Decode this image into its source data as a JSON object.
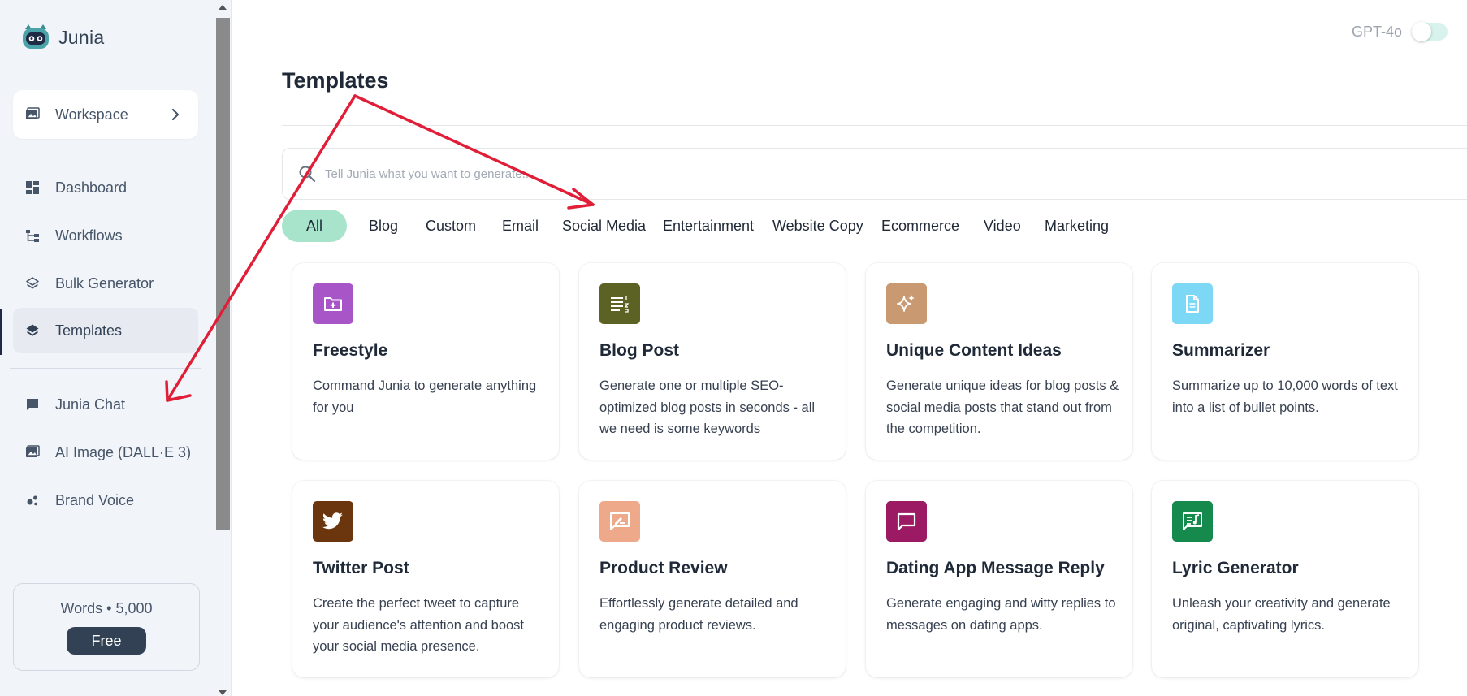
{
  "app": {
    "name": "Junia"
  },
  "sidebar": {
    "workspace": {
      "label": "Workspace",
      "icon": "image-icon"
    },
    "items": [
      {
        "label": "Dashboard",
        "icon": "dashboard-icon"
      },
      {
        "label": "Workflows",
        "icon": "workflows-icon"
      },
      {
        "label": "Bulk Generator",
        "icon": "layers-icon"
      },
      {
        "label": "Templates",
        "icon": "layers-filled-icon",
        "active": true
      },
      {
        "label": "Junia Chat",
        "icon": "chat-icon"
      },
      {
        "label": "AI Image (DALL·E 3)",
        "icon": "image-icon"
      },
      {
        "label": "Brand Voice",
        "icon": "bubbles-icon"
      }
    ],
    "usage": {
      "words": "Words • 5,000",
      "plan": "Free"
    }
  },
  "header": {
    "model_label": "GPT-4o",
    "model_toggle_on": false
  },
  "main": {
    "title": "Templates",
    "search": {
      "placeholder": "Tell Junia what you want to generate..."
    },
    "categories": [
      "All",
      "Blog",
      "Custom",
      "Email",
      "Social Media",
      "Entertainment",
      "Website Copy",
      "Ecommerce",
      "Video",
      "Marketing"
    ],
    "active_category": "All",
    "templates": [
      {
        "title": "Freestyle",
        "description": "Command Junia to generate anything for you",
        "icon": "folder-plus-icon",
        "color": "#a855c8"
      },
      {
        "title": "Blog Post",
        "description": "Generate one or multiple SEO-optimized blog posts in seconds - all we need is some keywords",
        "icon": "list-numbered-icon",
        "color": "#5c6124"
      },
      {
        "title": "Unique Content Ideas",
        "description": "Generate unique ideas for blog posts & social media posts that stand out from the competition.",
        "icon": "sparkles-icon",
        "color": "#c99a72"
      },
      {
        "title": "Summarizer",
        "description": "Summarize up to 10,000 words of text into a list of bullet points.",
        "icon": "document-icon",
        "color": "#7dd8f5"
      },
      {
        "title": "Twitter Post",
        "description": "Create the perfect tweet to capture your audience's attention and boost your social media presence.",
        "icon": "twitter-icon",
        "color": "#6b360d"
      },
      {
        "title": "Product Review",
        "description": "Effortlessly generate detailed and engaging product reviews.",
        "icon": "rate-review-icon",
        "color": "#eea98a"
      },
      {
        "title": "Dating App Message Reply",
        "description": "Generate engaging and witty replies to messages on dating apps.",
        "icon": "message-icon",
        "color": "#9c1a63"
      },
      {
        "title": "Lyric Generator",
        "description": "Unleash your creativity and generate original, captivating lyrics.",
        "icon": "lyrics-icon",
        "color": "#168a4d"
      }
    ]
  },
  "annotation": {
    "color": "#e01e37"
  }
}
